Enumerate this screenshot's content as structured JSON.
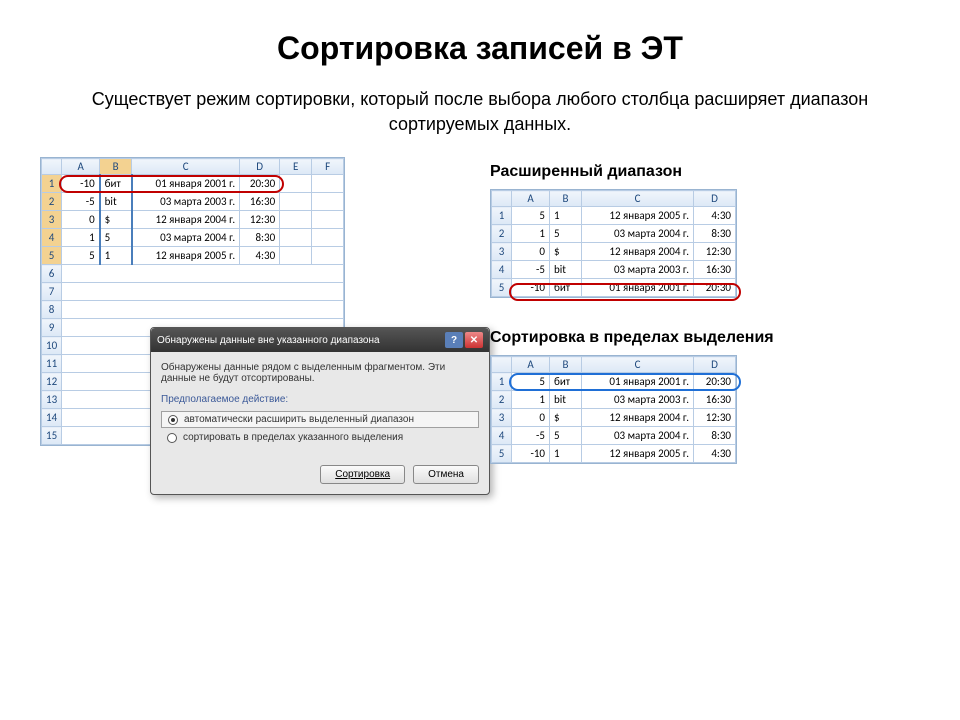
{
  "title": "Сортировка записей в ЭТ",
  "subtitle": "Существует режим сортировки, который после выбора любого столбца расширяет диапазон сортируемых данных.",
  "labels": {
    "extended": "Расширенный диапазон",
    "within": "Сортировка в пределах выделения"
  },
  "columns": [
    "A",
    "B",
    "C",
    "D",
    "E",
    "F"
  ],
  "columns_short": [
    "A",
    "B",
    "C",
    "D"
  ],
  "sheet_left": {
    "rows": [
      {
        "n": "1",
        "a": "-10",
        "b": "бит",
        "c": "01 января 2001 г.",
        "d": "20:30"
      },
      {
        "n": "2",
        "a": "-5",
        "b": "bit",
        "c": "03 марта 2003 г.",
        "d": "16:30"
      },
      {
        "n": "3",
        "a": "0",
        "b": "$",
        "c": "12 января 2004 г.",
        "d": "12:30"
      },
      {
        "n": "4",
        "a": "1",
        "b": "5",
        "c": "03 марта 2004 г.",
        "d": "8:30"
      },
      {
        "n": "5",
        "a": "5",
        "b": "1",
        "c": "12 января 2005 г.",
        "d": "4:30"
      }
    ],
    "extra_rows": [
      "6",
      "7",
      "8",
      "9",
      "10",
      "11",
      "12",
      "13",
      "14",
      "15"
    ]
  },
  "sheet_extended": {
    "rows": [
      {
        "n": "1",
        "a": "5",
        "b": "1",
        "c": "12 января 2005 г.",
        "d": "4:30"
      },
      {
        "n": "2",
        "a": "1",
        "b": "5",
        "c": "03 марта 2004 г.",
        "d": "8:30"
      },
      {
        "n": "3",
        "a": "0",
        "b": "$",
        "c": "12 января 2004 г.",
        "d": "12:30"
      },
      {
        "n": "4",
        "a": "-5",
        "b": "bit",
        "c": "03 марта 2003 г.",
        "d": "16:30"
      },
      {
        "n": "5",
        "a": "-10",
        "b": "бит",
        "c": "01 января 2001 г.",
        "d": "20:30"
      }
    ]
  },
  "sheet_within": {
    "rows": [
      {
        "n": "1",
        "a": "5",
        "b": "бит",
        "c": "01 января 2001 г.",
        "d": "20:30"
      },
      {
        "n": "2",
        "a": "1",
        "b": "bit",
        "c": "03 марта 2003 г.",
        "d": "16:30"
      },
      {
        "n": "3",
        "a": "0",
        "b": "$",
        "c": "12 января 2004 г.",
        "d": "12:30"
      },
      {
        "n": "4",
        "a": "-5",
        "b": "5",
        "c": "03 марта 2004 г.",
        "d": "8:30"
      },
      {
        "n": "5",
        "a": "-10",
        "b": "1",
        "c": "12 января 2005 г.",
        "d": "4:30"
      }
    ]
  },
  "dialog": {
    "title": "Обнаружены данные вне указанного диапазона",
    "message": "Обнаружены данные рядом с выделенным фрагментом. Эти данные не будут отсортированы.",
    "section": "Предполагаемое действие:",
    "opt1": "автоматически расширить выделенный диапазон",
    "opt2": "сортировать в пределах указанного выделения",
    "sort_btn": "Сортировка",
    "cancel_btn": "Отмена"
  }
}
